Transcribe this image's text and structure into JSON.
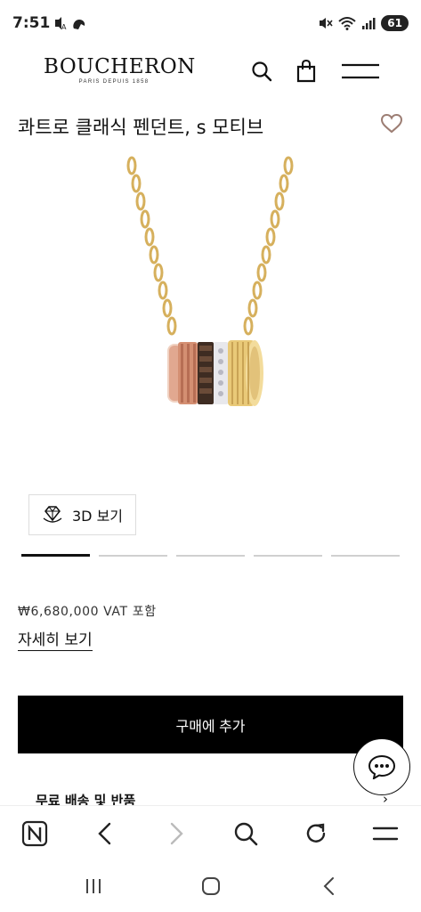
{
  "status_bar": {
    "time": "7:51",
    "battery": "61",
    "icons": [
      "no-sound-icon",
      "notification-icon",
      "mute-icon",
      "wifi-icon",
      "signal-icon"
    ]
  },
  "header": {
    "logo_text": "BOUCHERON",
    "logo_subtext": "PARIS DEPUIS 1858",
    "icons": [
      "search-icon",
      "bag-icon",
      "menu-icon"
    ]
  },
  "product": {
    "title": "콰트로 클래식 펜던트, s 모티브",
    "price": "₩6,680,000 VAT 포함",
    "details_link": "자세히 보기",
    "view_3d_label": "3D 보기",
    "gallery_pages": 5,
    "gallery_active_index": 0
  },
  "actions": {
    "add_to_cart": "구매에 추가",
    "shipping_label": "무료 배송 및 반품"
  },
  "browser_bar": {
    "icons": [
      "n-home-icon",
      "back-icon",
      "forward-icon",
      "search-icon",
      "reload-icon",
      "menu-icon"
    ]
  },
  "android_nav": {
    "icons": [
      "recent-apps-icon",
      "home-icon",
      "back-icon"
    ]
  },
  "colors": {
    "accent": "#000000",
    "heart": "#9c7d73",
    "gold": "#e2c27a",
    "rose_gold": "#d99a7f",
    "brown": "#4a3427"
  }
}
